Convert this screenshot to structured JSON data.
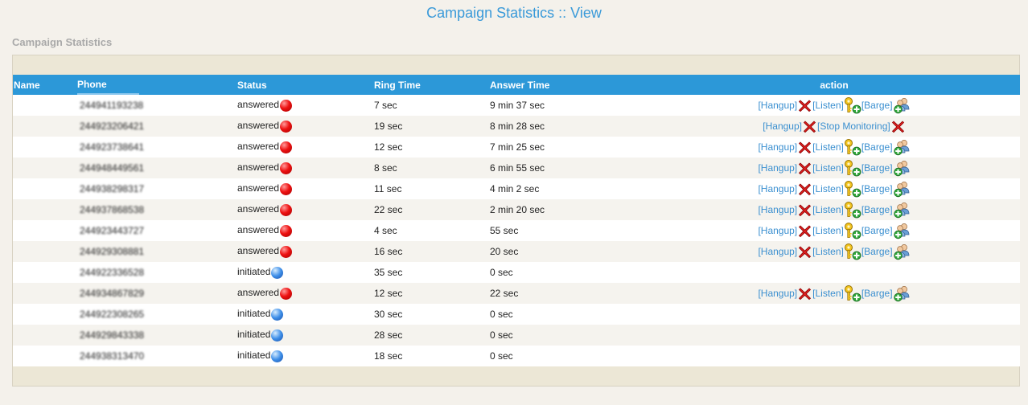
{
  "page_title": "Campaign Statistics :: View",
  "section_title": "Campaign Statistics",
  "columns": {
    "name": "Name",
    "phone": "Phone",
    "status": "Status",
    "ring_time": "Ring Time",
    "answer_time": "Answer Time",
    "action": "action"
  },
  "action_labels": {
    "hangup": "[Hangup]",
    "listen": "[Listen]",
    "barge": "[Barge]",
    "stop_monitoring": "[Stop Monitoring]"
  },
  "status_colors": {
    "answered": "#ee1111",
    "initiated": "#3d8ee8"
  },
  "rows": [
    {
      "name": "",
      "phone": "244941193238",
      "status": "answered",
      "ring_time": "7 sec",
      "answer_time": "9 min 37 sec",
      "actions": "listen"
    },
    {
      "name": "",
      "phone": "244923206421",
      "status": "answered",
      "ring_time": "19 sec",
      "answer_time": "8 min 28 sec",
      "actions": "stop"
    },
    {
      "name": "",
      "phone": "244923738641",
      "status": "answered",
      "ring_time": "12 sec",
      "answer_time": "7 min 25 sec",
      "actions": "listen"
    },
    {
      "name": "",
      "phone": "244948449561",
      "status": "answered",
      "ring_time": "8 sec",
      "answer_time": "6 min 55 sec",
      "actions": "listen"
    },
    {
      "name": "",
      "phone": "244938298317",
      "status": "answered",
      "ring_time": "11 sec",
      "answer_time": "4 min 2 sec",
      "actions": "listen"
    },
    {
      "name": "",
      "phone": "244937868538",
      "status": "answered",
      "ring_time": "22 sec",
      "answer_time": "2 min 20 sec",
      "actions": "listen"
    },
    {
      "name": "",
      "phone": "244923443727",
      "status": "answered",
      "ring_time": "4 sec",
      "answer_time": "55 sec",
      "actions": "listen"
    },
    {
      "name": "",
      "phone": "244929308881",
      "status": "answered",
      "ring_time": "16 sec",
      "answer_time": "20 sec",
      "actions": "listen"
    },
    {
      "name": "",
      "phone": "244922336528",
      "status": "initiated",
      "ring_time": "35 sec",
      "answer_time": "0 sec",
      "actions": "none"
    },
    {
      "name": "",
      "phone": "244934867829",
      "status": "answered",
      "ring_time": "12 sec",
      "answer_time": "22 sec",
      "actions": "listen"
    },
    {
      "name": "",
      "phone": "244922308265",
      "status": "initiated",
      "ring_time": "30 sec",
      "answer_time": "0 sec",
      "actions": "none"
    },
    {
      "name": "",
      "phone": "244929843338",
      "status": "initiated",
      "ring_time": "28 sec",
      "answer_time": "0 sec",
      "actions": "none"
    },
    {
      "name": "",
      "phone": "244938313470",
      "status": "initiated",
      "ring_time": "18 sec",
      "answer_time": "0 sec",
      "actions": "none"
    }
  ]
}
